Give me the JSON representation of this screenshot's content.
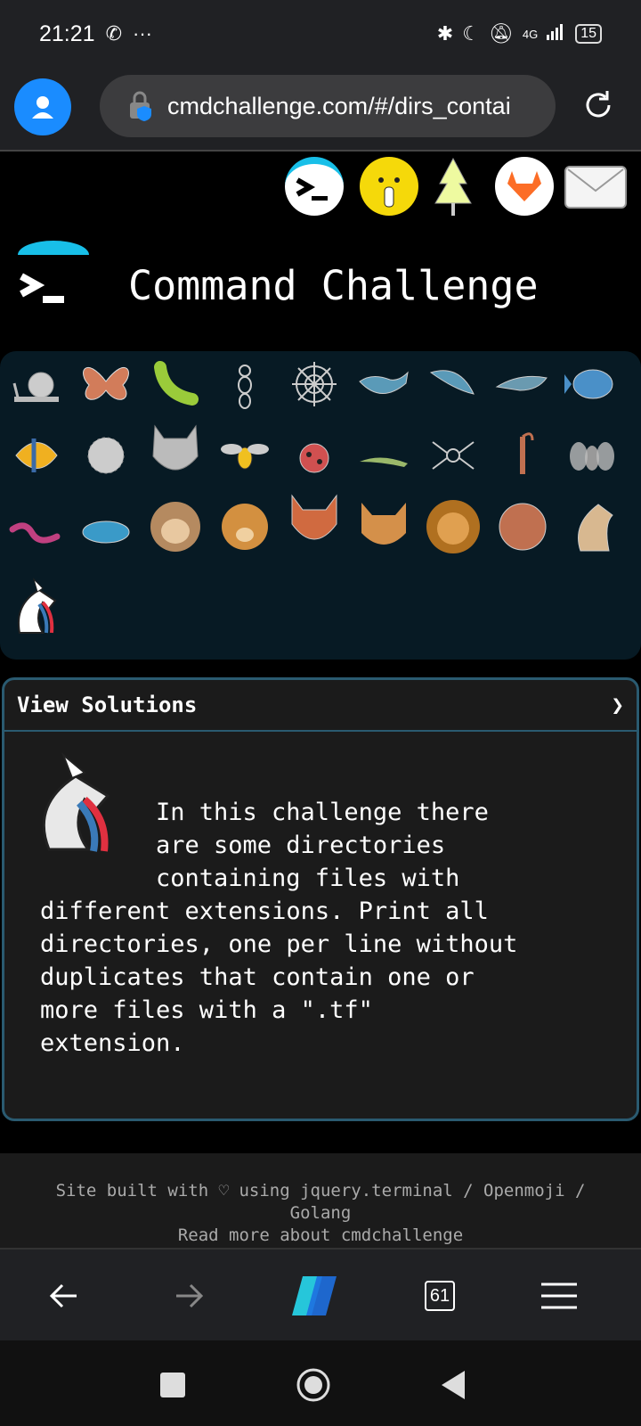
{
  "status": {
    "time": "21:21",
    "network": "4G",
    "battery": "15"
  },
  "browser": {
    "url": "cmdchallenge.com/#/dirs_contai",
    "tab_count": "61"
  },
  "site": {
    "title": "Command Challenge"
  },
  "animals": [
    "snail",
    "butterfly",
    "caterpillar",
    "ant",
    "spider-web",
    "whale",
    "shark",
    "dolphin",
    "fish",
    "tropical-fish",
    "blowfish",
    "wolf",
    "bee",
    "ladybug",
    "cricket",
    "spider",
    "scorpion",
    "fly",
    "worm",
    "microbe",
    "monkey",
    "dog",
    "fox",
    "cat",
    "lion",
    "tiger",
    "horse",
    "unicorn"
  ],
  "panel": {
    "header": "View Solutions",
    "chevron": "❯",
    "line1": "In this challenge there",
    "line2": "are some directories",
    "line3": "containing files with",
    "line4": "different extensions. Print all",
    "line5": "directories, one per line without",
    "line6": "duplicates that contain one or",
    "line7": "more files with a \".tf\"",
    "line8": "extension."
  },
  "footer": {
    "line1": "Site built with ♡ using jquery.terminal / Openmoji /",
    "line2": "Golang",
    "line3": "Read more about cmdchallenge"
  },
  "colors": {
    "accent": "#1a8cff",
    "panel_border": "#2a5a70",
    "animals_bg": "#071a24"
  }
}
